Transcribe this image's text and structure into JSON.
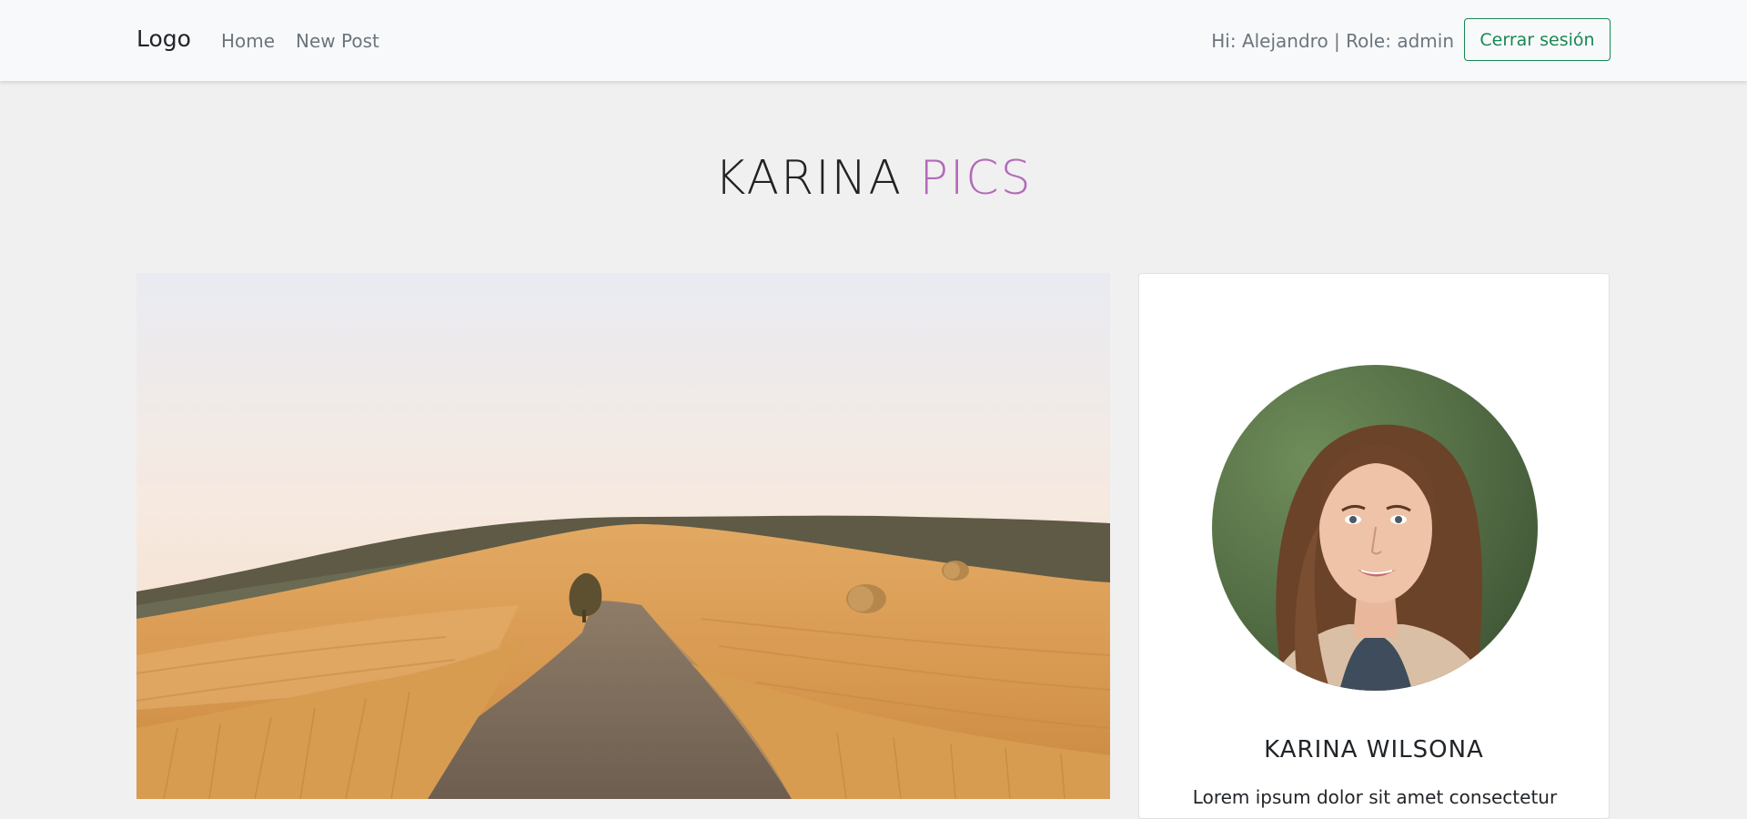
{
  "navbar": {
    "brand": "Logo",
    "links": [
      {
        "label": "Home"
      },
      {
        "label": "New Post"
      }
    ],
    "greeting": "Hi: Alejandro | Role: admin",
    "logout_label": "Cerrar sesión"
  },
  "header": {
    "title_main": "KARINA",
    "title_accent": "PICS"
  },
  "profile": {
    "name": "KARINA WILSONA",
    "bio": "Lorem ipsum dolor sit amet consectetur"
  },
  "colors": {
    "accent_purple": "#b36ab8",
    "success_green": "#198754",
    "page_background": "#f0f0f0"
  }
}
